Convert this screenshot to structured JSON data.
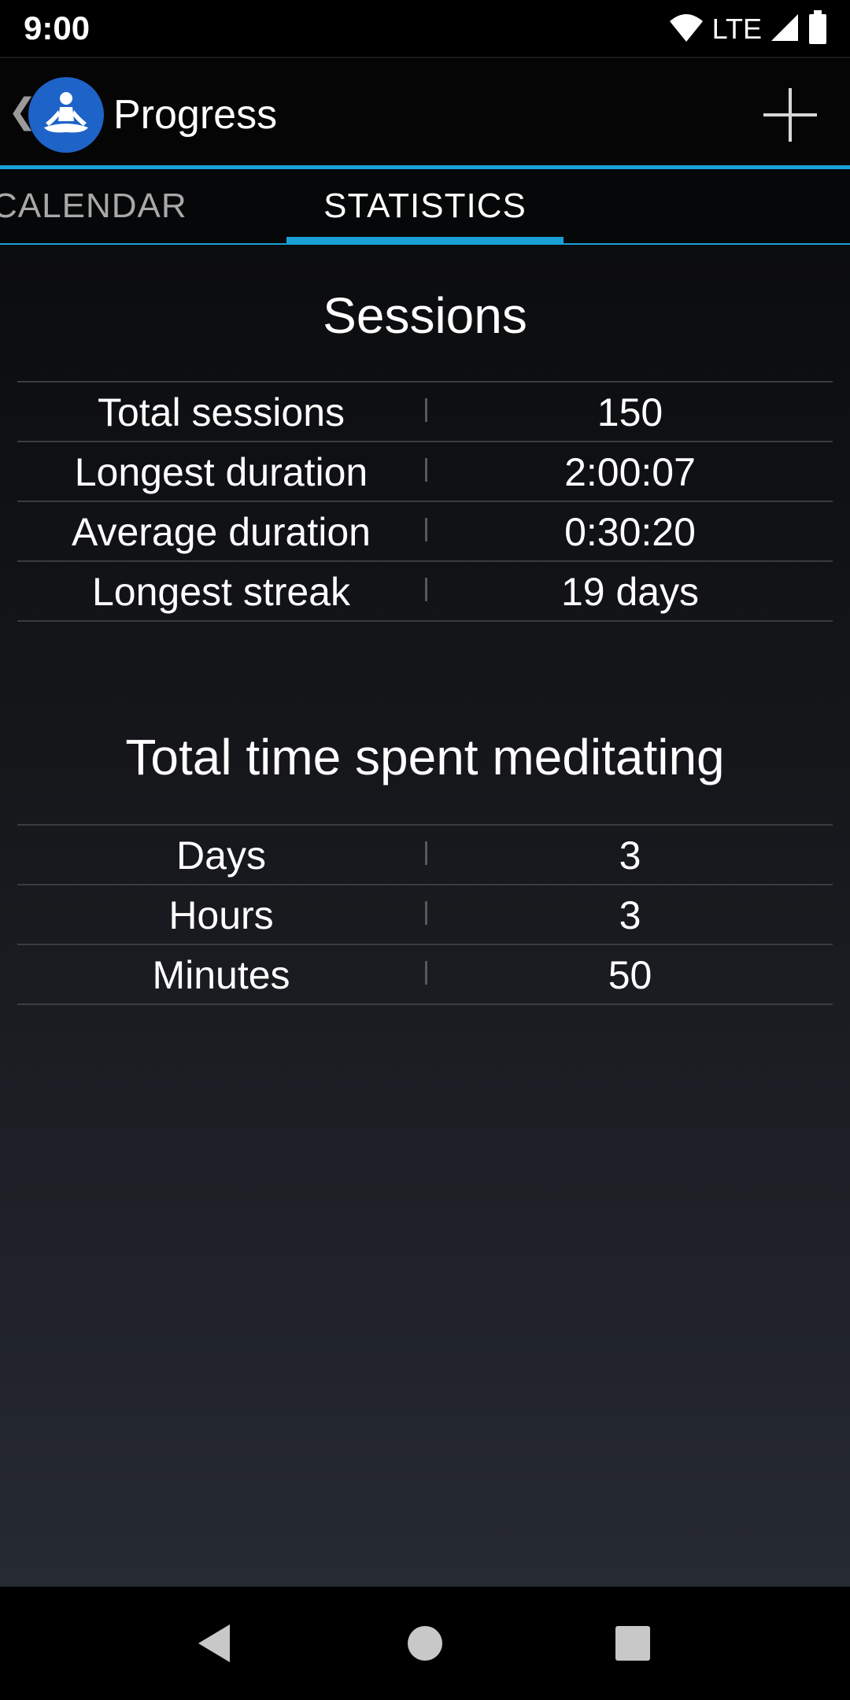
{
  "status_bar": {
    "time": "9:00",
    "network": "LTE",
    "icons": [
      "wifi-icon",
      "signal-icon",
      "battery-icon"
    ]
  },
  "action_bar": {
    "back_glyph": "❮",
    "title": "Progress",
    "logo_icon": "meditation-icon",
    "add_icon": "plus-icon"
  },
  "tabs": [
    {
      "label": "CALENDAR",
      "selected": false
    },
    {
      "label": "STATISTICS",
      "selected": true
    }
  ],
  "sessions": {
    "title": "Sessions",
    "rows": [
      {
        "label": "Total sessions",
        "value": "150"
      },
      {
        "label": "Longest duration",
        "value": "2:00:07"
      },
      {
        "label": "Average duration",
        "value": "0:30:20"
      },
      {
        "label": "Longest streak",
        "value": "19 days"
      }
    ]
  },
  "total_time": {
    "title": "Total time spent meditating",
    "rows": [
      {
        "label": "Days",
        "value": "3"
      },
      {
        "label": "Hours",
        "value": "3"
      },
      {
        "label": "Minutes",
        "value": "50"
      }
    ]
  },
  "nav_bar": {
    "icons": [
      "back-icon",
      "home-icon",
      "recents-icon"
    ]
  },
  "colors": {
    "accent": "#1aa0d8",
    "logo": "#1e63c8",
    "divider": "#3a3c40"
  }
}
